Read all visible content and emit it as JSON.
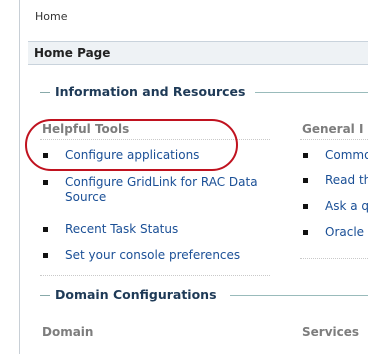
{
  "breadcrumb": "Home",
  "page_title": "Home Page",
  "sections": {
    "info": "Information and Resources",
    "domain": "Domain Configurations"
  },
  "helpful_tools": {
    "heading": "Helpful Tools",
    "items": [
      "Configure applications",
      "Configure GridLink for RAC Data",
      "Source",
      "Recent Task Status",
      "Set your console preferences"
    ]
  },
  "general_info": {
    "heading": "General I",
    "items": [
      "Commo",
      "Read th",
      "Ask a q",
      "Oracle "
    ]
  },
  "domain_cols": {
    "domain": "Domain",
    "services": "Services"
  },
  "colors": {
    "link": "#1a4f96",
    "section_title": "#1e3a57",
    "annotation": "#c0121f"
  }
}
